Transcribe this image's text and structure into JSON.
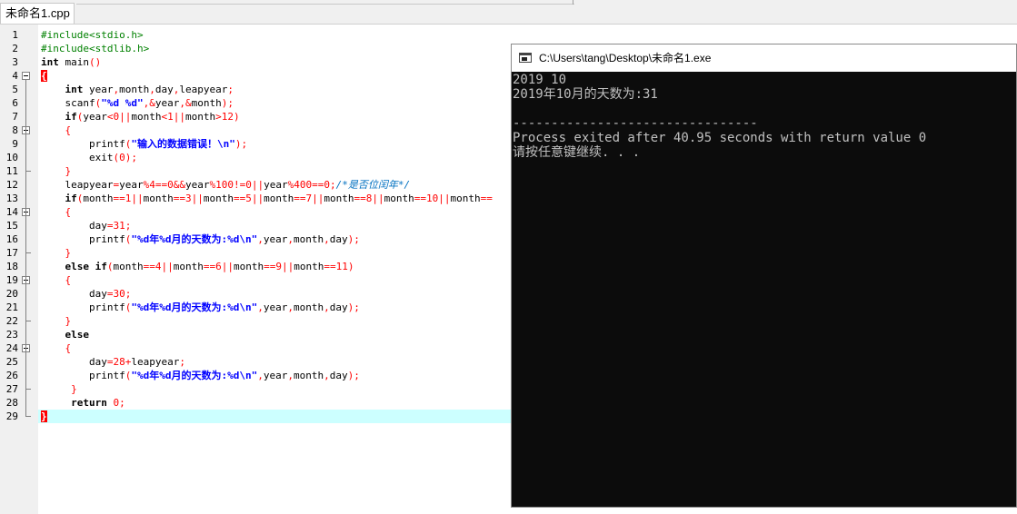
{
  "tab": {
    "label": "未命名1.cpp"
  },
  "editor": {
    "lines": [
      {
        "n": "1",
        "html": "<span class='pp'>#include&lt;stdio.h&gt;</span>"
      },
      {
        "n": "2",
        "html": "<span class='pp'>#include&lt;stdlib.h&gt;</span>"
      },
      {
        "n": "3",
        "html": "<span class='kw'>int</span> main<span class='op'>()</span>"
      },
      {
        "n": "4",
        "html": "<span class='brace-hl'>{</span>"
      },
      {
        "n": "5",
        "html": "    <span class='kw'>int</span> year<span class='op'>,</span>month<span class='op'>,</span>day<span class='op'>,</span>leapyear<span class='op'>;</span>"
      },
      {
        "n": "6",
        "html": "    scanf<span class='op'>(</span><span class='str'>\"%d %d\"</span><span class='op'>,&amp;</span>year<span class='op'>,&amp;</span>month<span class='op'>);</span>"
      },
      {
        "n": "7",
        "html": "    <span class='kw'>if</span><span class='op'>(</span>year<span class='op'>&lt;</span><span class='num'>0</span><span class='op'>||</span>month<span class='op'>&lt;</span><span class='num'>1</span><span class='op'>||</span>month<span class='op'>&gt;</span><span class='num'>12</span><span class='op'>)</span>"
      },
      {
        "n": "8",
        "html": "    <span class='op'>{</span>"
      },
      {
        "n": "9",
        "html": "        printf<span class='op'>(</span><span class='str'>\"输入的数据错误！\\n\"</span><span class='op'>);</span>"
      },
      {
        "n": "10",
        "html": "        exit<span class='op'>(</span><span class='num'>0</span><span class='op'>);</span>"
      },
      {
        "n": "11",
        "html": "    <span class='op'>}</span>"
      },
      {
        "n": "12",
        "html": "    leapyear<span class='op'>=</span>year<span class='op'>%</span><span class='num'>4</span><span class='op'>==</span><span class='num'>0</span><span class='op'>&amp;&amp;</span>year<span class='op'>%</span><span class='num'>100</span><span class='op'>!=</span><span class='num'>0</span><span class='op'>||</span>year<span class='op'>%</span><span class='num'>400</span><span class='op'>==</span><span class='num'>0</span><span class='op'>;</span><span class='cmt'>/*是否位闰年*/</span>"
      },
      {
        "n": "13",
        "html": "    <span class='kw'>if</span><span class='op'>(</span>month<span class='op'>==</span><span class='num'>1</span><span class='op'>||</span>month<span class='op'>==</span><span class='num'>3</span><span class='op'>||</span>month<span class='op'>==</span><span class='num'>5</span><span class='op'>||</span>month<span class='op'>==</span><span class='num'>7</span><span class='op'>||</span>month<span class='op'>==</span><span class='num'>8</span><span class='op'>||</span>month<span class='op'>==</span><span class='num'>10</span><span class='op'>||</span>month<span class='op'>==</span>"
      },
      {
        "n": "14",
        "html": "    <span class='op'>{</span>"
      },
      {
        "n": "15",
        "html": "        day<span class='op'>=</span><span class='num'>31</span><span class='op'>;</span>"
      },
      {
        "n": "16",
        "html": "        printf<span class='op'>(</span><span class='str'>\"%d年%d月的天数为:%d\\n\"</span><span class='op'>,</span>year<span class='op'>,</span>month<span class='op'>,</span>day<span class='op'>);</span>"
      },
      {
        "n": "17",
        "html": "    <span class='op'>}</span>"
      },
      {
        "n": "18",
        "html": "    <span class='kw'>else if</span><span class='op'>(</span>month<span class='op'>==</span><span class='num'>4</span><span class='op'>||</span>month<span class='op'>==</span><span class='num'>6</span><span class='op'>||</span>month<span class='op'>==</span><span class='num'>9</span><span class='op'>||</span>month<span class='op'>==</span><span class='num'>11</span><span class='op'>)</span>"
      },
      {
        "n": "19",
        "html": "    <span class='op'>{</span>"
      },
      {
        "n": "20",
        "html": "        day<span class='op'>=</span><span class='num'>30</span><span class='op'>;</span>"
      },
      {
        "n": "21",
        "html": "        printf<span class='op'>(</span><span class='str'>\"%d年%d月的天数为:%d\\n\"</span><span class='op'>,</span>year<span class='op'>,</span>month<span class='op'>,</span>day<span class='op'>);</span>"
      },
      {
        "n": "22",
        "html": "    <span class='op'>}</span>"
      },
      {
        "n": "23",
        "html": "    <span class='kw'>else</span>"
      },
      {
        "n": "24",
        "html": "    <span class='op'>{</span>"
      },
      {
        "n": "25",
        "html": "        day<span class='op'>=</span><span class='num'>28</span><span class='op'>+</span>leapyear<span class='op'>;</span>"
      },
      {
        "n": "26",
        "html": "        printf<span class='op'>(</span><span class='str'>\"%d年%d月的天数为:%d\\n\"</span><span class='op'>,</span>year<span class='op'>,</span>month<span class='op'>,</span>day<span class='op'>);</span>"
      },
      {
        "n": "27",
        "html": "     <span class='op'>}</span>"
      },
      {
        "n": "28",
        "html": "     <span class='kw'>return</span> <span class='num'>0</span><span class='op'>;</span>"
      },
      {
        "n": "29",
        "html": "<span class='brace-hl'>}</span>"
      }
    ]
  },
  "console": {
    "title": "C:\\Users\\tang\\Desktop\\未命名1.exe",
    "lines": [
      "2019 10",
      "2019年10月的天数为:31",
      "",
      "--------------------------------",
      "Process exited after 40.95 seconds with return value 0",
      "请按任意键继续. . ."
    ]
  }
}
